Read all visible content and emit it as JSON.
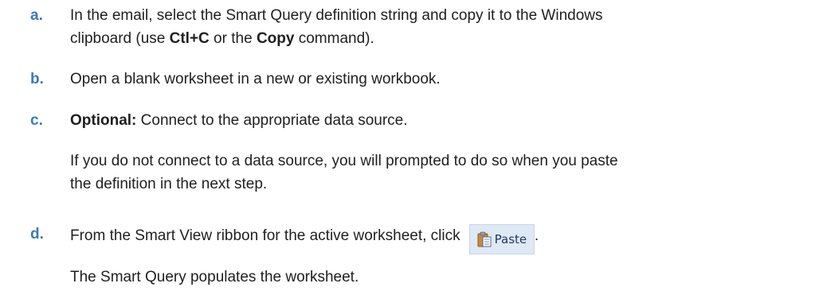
{
  "steps": [
    {
      "marker": "a.",
      "line1": "In the email, select the Smart Query definition string and copy it to the Windows",
      "line2_pre": "clipboard (use ",
      "line2_bold1": "Ctl+C",
      "line2_mid": " or the ",
      "line2_bold2": "Copy",
      "line2_post": " command)."
    },
    {
      "marker": "b.",
      "text": "Open a blank worksheet in a new or existing workbook."
    },
    {
      "marker": "c.",
      "bold": "Optional:",
      "text": " Connect to the appropriate data source.",
      "note_line1": "If you do not connect to a data source, you will prompted to do so when you paste",
      "note_line2": "the definition in the next step."
    },
    {
      "marker": "d.",
      "text": "From the Smart View ribbon for the active worksheet, click ",
      "button_label": "Paste",
      "after": ".",
      "result": "The Smart Query populates the worksheet."
    }
  ],
  "colors": {
    "marker": "#3d7ab8",
    "text": "#1f1f1f",
    "button_bg": "#dfe9f5"
  },
  "icons": {
    "paste": "clipboard-paste-icon"
  }
}
